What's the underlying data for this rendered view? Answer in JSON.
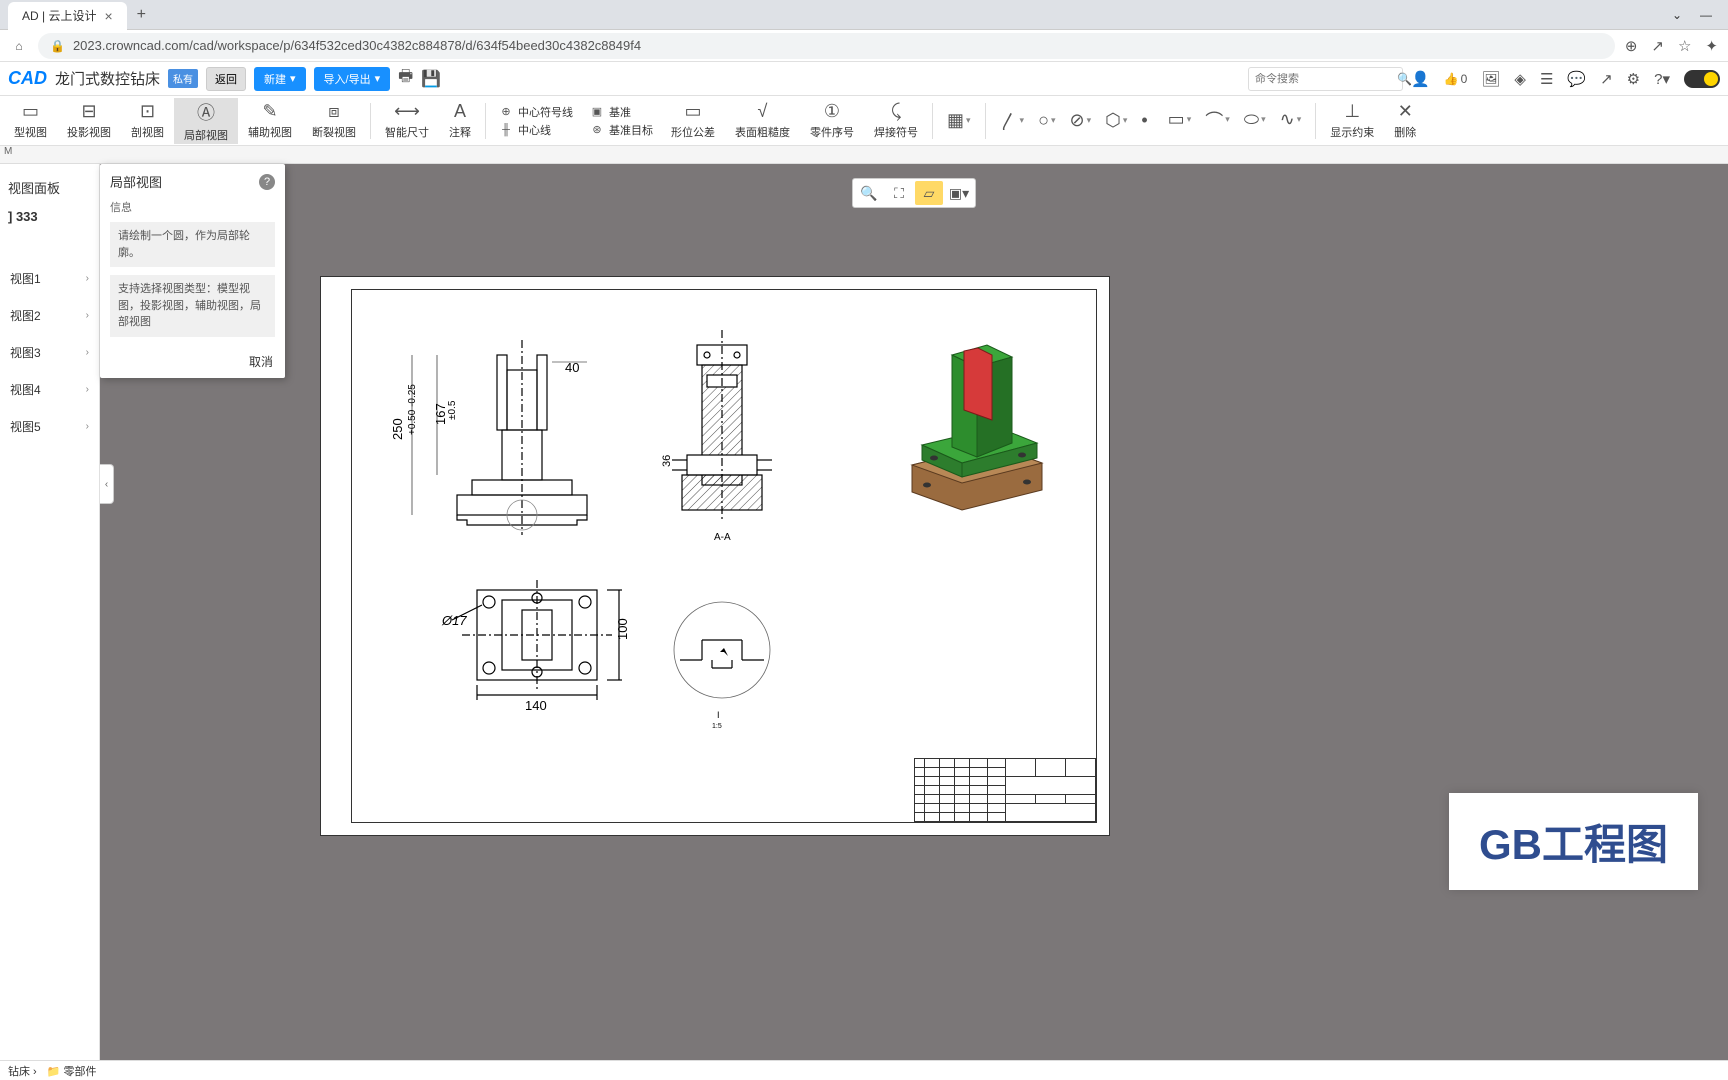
{
  "browser": {
    "tab_title": "AD | 云上设计",
    "url": "2023.crowncad.com/cad/workspace/p/634f532ced30c4382c884878/d/634f54beed30c4382c8849f4"
  },
  "app": {
    "logo": "CAD",
    "doc_title": "龙门式数控钻床",
    "privacy_badge": "私有",
    "back_btn": "返回",
    "new_btn": "新建",
    "io_btn": "导入/导出",
    "search_placeholder": "命令搜索",
    "like_count": "0"
  },
  "ribbon": {
    "items": [
      {
        "label": "型视图"
      },
      {
        "label": "投影视图"
      },
      {
        "label": "剖视图"
      },
      {
        "label": "局部视图"
      },
      {
        "label": "辅助视图"
      },
      {
        "label": "断裂视图"
      },
      {
        "label": "智能尺寸"
      },
      {
        "label": "注释"
      }
    ],
    "center1_top": "中心符号线",
    "center1_bot": "中心线",
    "datum_top": "基准",
    "datum_bot": "基准目标",
    "geo_tol": "形位公差",
    "rough": "表面粗糙度",
    "part_no": "零件序号",
    "weld": "焊接符号",
    "constraints": "显示约束",
    "delete": "删除"
  },
  "sec_bar": "M",
  "left_panel": {
    "title": "视图面板",
    "doc": "333",
    "items": [
      "视图1",
      "视图2",
      "视图3",
      "视图4",
      "视图5"
    ]
  },
  "popup": {
    "title": "局部视图",
    "sub": "信息",
    "box1": "请绘制一个圆，作为局部轮廓。",
    "box2": "支持选择视图类型：模型视图，投影视图，辅助视图，局部视图",
    "cancel": "取消"
  },
  "drawing": {
    "dims": {
      "d1": "250",
      "d2": "+0.50\n-0.25",
      "d3": "167",
      "d4": "±0.5",
      "d5": "40",
      "d6": "36",
      "d7": "100",
      "d8": "140",
      "dia": "Ø17",
      "sec": "A-A",
      "detail": "I",
      "scale": "1:5"
    }
  },
  "watermark": "GB工程图",
  "footer": {
    "item1": "钻床",
    "item2": "零部件"
  }
}
